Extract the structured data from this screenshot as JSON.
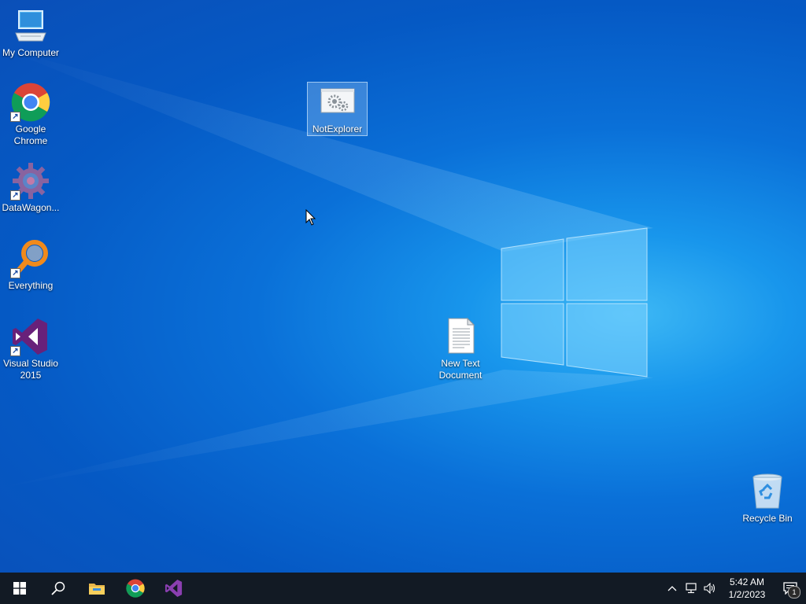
{
  "desktop": {
    "icons": [
      {
        "name": "my-computer",
        "label": "My Computer"
      },
      {
        "name": "google-chrome",
        "label": "Google Chrome"
      },
      {
        "name": "datawagon",
        "label": "DataWagon..."
      },
      {
        "name": "everything",
        "label": "Everything"
      },
      {
        "name": "visual-studio-2015",
        "label": "Visual Studio 2015"
      },
      {
        "name": "notexplorer",
        "label": "NotExplorer"
      },
      {
        "name": "new-text-document",
        "label": "New Text Document"
      },
      {
        "name": "recycle-bin",
        "label": "Recycle Bin"
      }
    ]
  },
  "taskbar": {
    "pinned": [
      "start-icon",
      "search-icon",
      "file-explorer-icon",
      "chrome-icon",
      "visual-studio-icon"
    ],
    "clock": {
      "time": "5:42 AM",
      "date": "1/2/2023"
    },
    "notification_count": "1"
  },
  "colors": {
    "desktop_accent": "#0a70d8",
    "taskbar_bg": "#121a24"
  }
}
